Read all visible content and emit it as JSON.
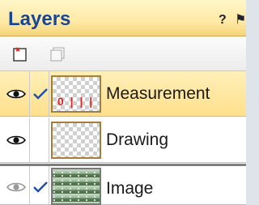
{
  "panel": {
    "title": "Layers",
    "help_label": "?",
    "pin_label": "⚑"
  },
  "toolbar": {
    "new_layer": "new-layer-icon",
    "duplicate_layer": "duplicate-layer-icon"
  },
  "layers": [
    {
      "name": "Measurement",
      "visible": true,
      "checked": true,
      "selected": true,
      "thumb_text": "0 | | |"
    },
    {
      "name": "Drawing",
      "visible": true,
      "checked": false,
      "selected": false
    },
    {
      "name": "Image",
      "visible": true,
      "checked": true,
      "selected": false
    }
  ],
  "colors": {
    "header_accent": "#ffe9a5",
    "title_blue": "#16469a",
    "selected_row": "#ffe08d"
  }
}
